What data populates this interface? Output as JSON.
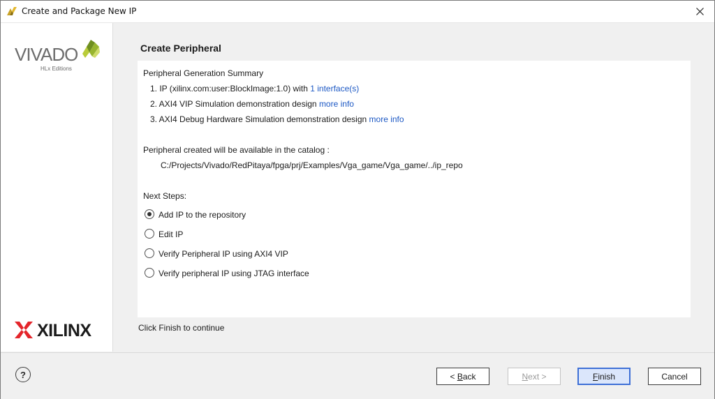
{
  "window": {
    "title": "Create and Package New IP"
  },
  "brand": {
    "vivado_text": "VIVADO",
    "vivado_sub": "HLx Editions",
    "xilinx_text": "XILINX"
  },
  "page": {
    "title": "Create Peripheral",
    "summary_heading": "Peripheral Generation Summary",
    "summary_items": [
      {
        "text": "1. IP (xilinx.com:user:BlockImage:1.0) with",
        "link": "1 interface(s)"
      },
      {
        "text": "2. AXI4 VIP Simulation demonstration design",
        "link": "more info"
      },
      {
        "text": "3. AXI4 Debug Hardware Simulation demonstration design",
        "link": "more info"
      }
    ],
    "catalog_label": "Peripheral created will be available in the catalog :",
    "catalog_path": "C:/Projects/Vivado/RedPitaya/fpga/prj/Examples/Vga_game/Vga_game/../ip_repo",
    "next_steps_label": "Next Steps:",
    "options": [
      {
        "label": "Add IP to the repository",
        "selected": true
      },
      {
        "label": "Edit IP",
        "selected": false
      },
      {
        "label": "Verify Peripheral IP using AXI4 VIP",
        "selected": false
      },
      {
        "label": "Verify peripheral IP using JTAG interface",
        "selected": false
      }
    ],
    "footer_hint": "Click Finish to continue"
  },
  "buttons": {
    "help": "?",
    "back_mnemonic": "B",
    "back_pre": "< ",
    "back_rest": "ack",
    "next_mnemonic": "N",
    "next_rest": "ext >",
    "finish_mnemonic": "F",
    "finish_rest": "inish",
    "cancel": "Cancel"
  },
  "colors": {
    "link": "#1c58c4",
    "accent": "#3d6fd6",
    "vivado_green": "#a5c135"
  }
}
